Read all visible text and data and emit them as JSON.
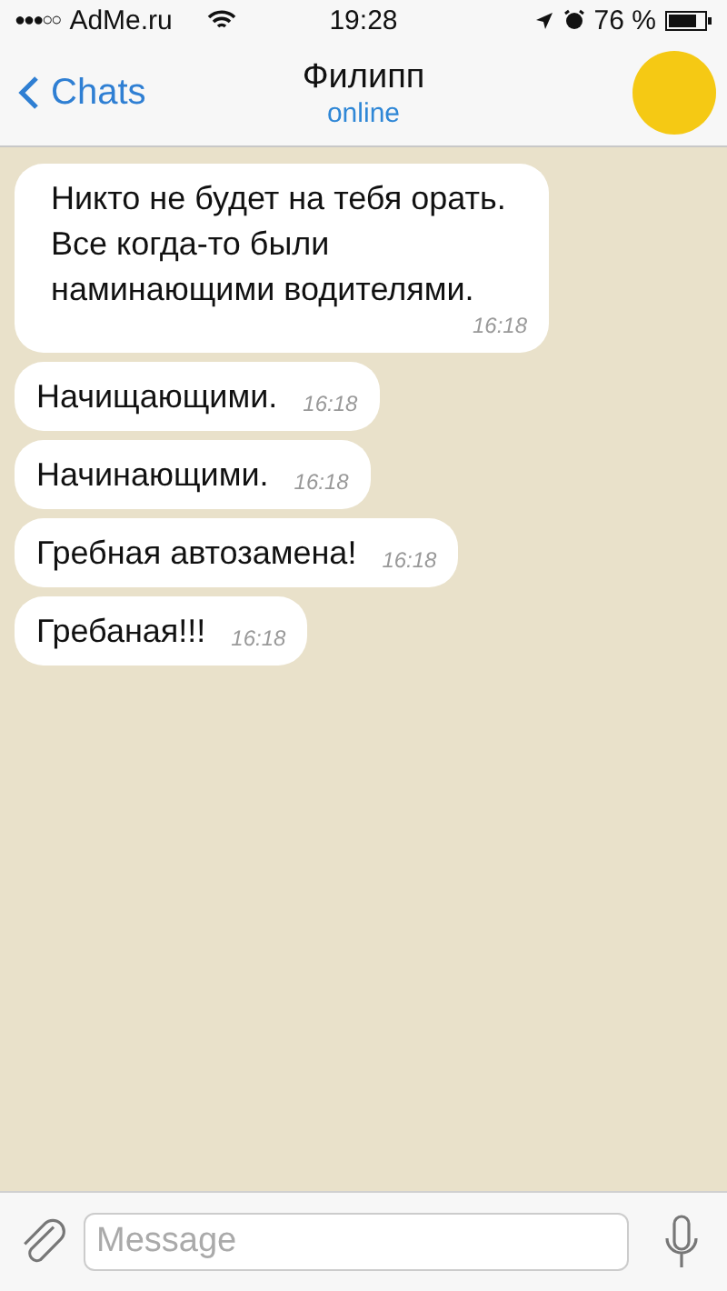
{
  "status_bar": {
    "signal_dots": "●●●○○",
    "carrier": "AdMe.ru",
    "time": "19:28",
    "battery": "76 %"
  },
  "header": {
    "back": "Chats",
    "title": "Филипп",
    "subtitle": "online"
  },
  "messages": [
    {
      "text": "Никто не будет на тебя орать. Все когда-то были наминающими водителями.",
      "time": "16:18"
    },
    {
      "text": "Начищающими.",
      "time": "16:18"
    },
    {
      "text": "Начинающими.",
      "time": "16:18"
    },
    {
      "text": "Гребная автозамена!",
      "time": "16:18"
    },
    {
      "text": "Гребаная!!!",
      "time": "16:18"
    }
  ],
  "composer": {
    "placeholder": "Message"
  }
}
